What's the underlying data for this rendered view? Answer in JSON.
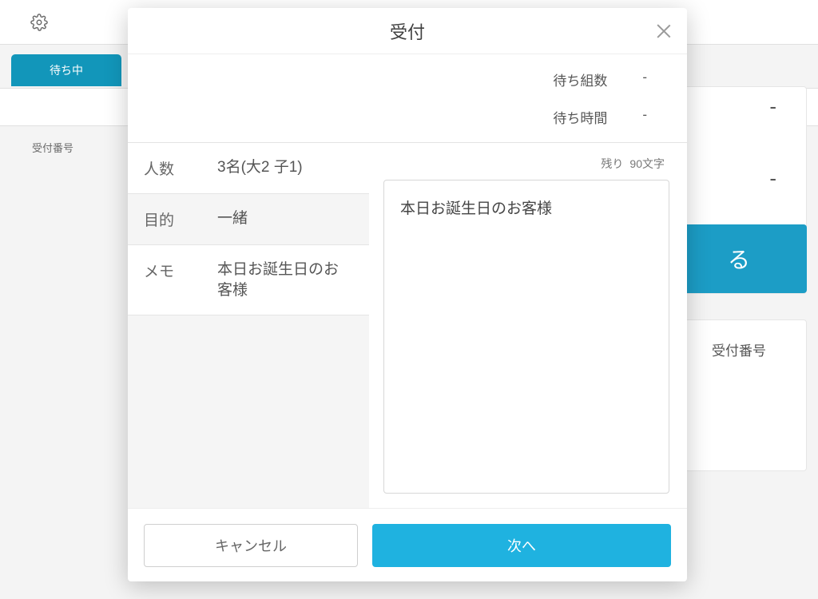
{
  "bg": {
    "tab_label": "待ち中",
    "header_col": "受付番号",
    "right_dash": "-",
    "right_btn_fragment": "る",
    "right_card2_label": "受付番号"
  },
  "modal": {
    "title": "受付",
    "info": {
      "wait_groups_label": "待ち組数",
      "wait_groups_value": "-",
      "wait_time_label": "待ち時間",
      "wait_time_value": "-"
    },
    "fields": {
      "count_label": "人数",
      "count_value": "3名(大2 子1)",
      "purpose_label": "目的",
      "purpose_value": "一緒",
      "memo_label": "メモ",
      "memo_value": "本日お誕生日のお客様"
    },
    "memo": {
      "remaining_label": "残り",
      "remaining_count": "90文字",
      "text": "本日お誕生日のお客様"
    },
    "buttons": {
      "cancel": "キャンセル",
      "next": "次へ"
    }
  }
}
